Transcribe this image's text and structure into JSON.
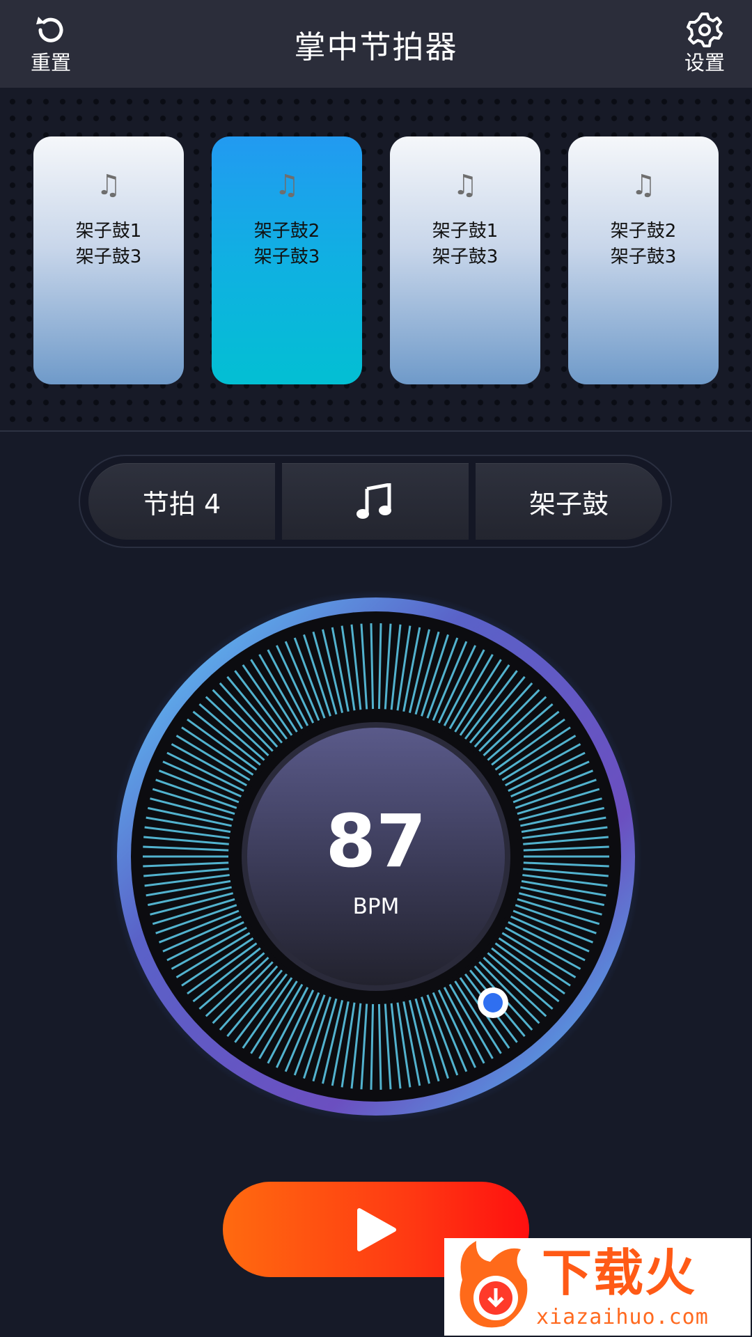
{
  "header": {
    "title": "掌中节拍器",
    "reset_label": "重置",
    "settings_label": "设置"
  },
  "cards": [
    {
      "line1": "架子鼓1",
      "line2": "架子鼓3",
      "active": false
    },
    {
      "line1": "架子鼓2",
      "line2": "架子鼓3",
      "active": true
    },
    {
      "line1": "架子鼓1",
      "line2": "架子鼓3",
      "active": false
    },
    {
      "line1": "架子鼓2",
      "line2": "架子鼓3",
      "active": false
    }
  ],
  "note_glyph": "♫",
  "controls": {
    "beat_label": "节拍 4",
    "note_icon": "music-note-icon",
    "sound_label": "架子鼓"
  },
  "tempo": {
    "value": "87",
    "unit": "BPM"
  },
  "watermark": {
    "text": "下载火",
    "url": "xiazaihuo.com"
  },
  "colors": {
    "active_card": "#1aa6ea",
    "play_button": "#ff3a12",
    "dial_ticks": "#5fd0f0"
  }
}
